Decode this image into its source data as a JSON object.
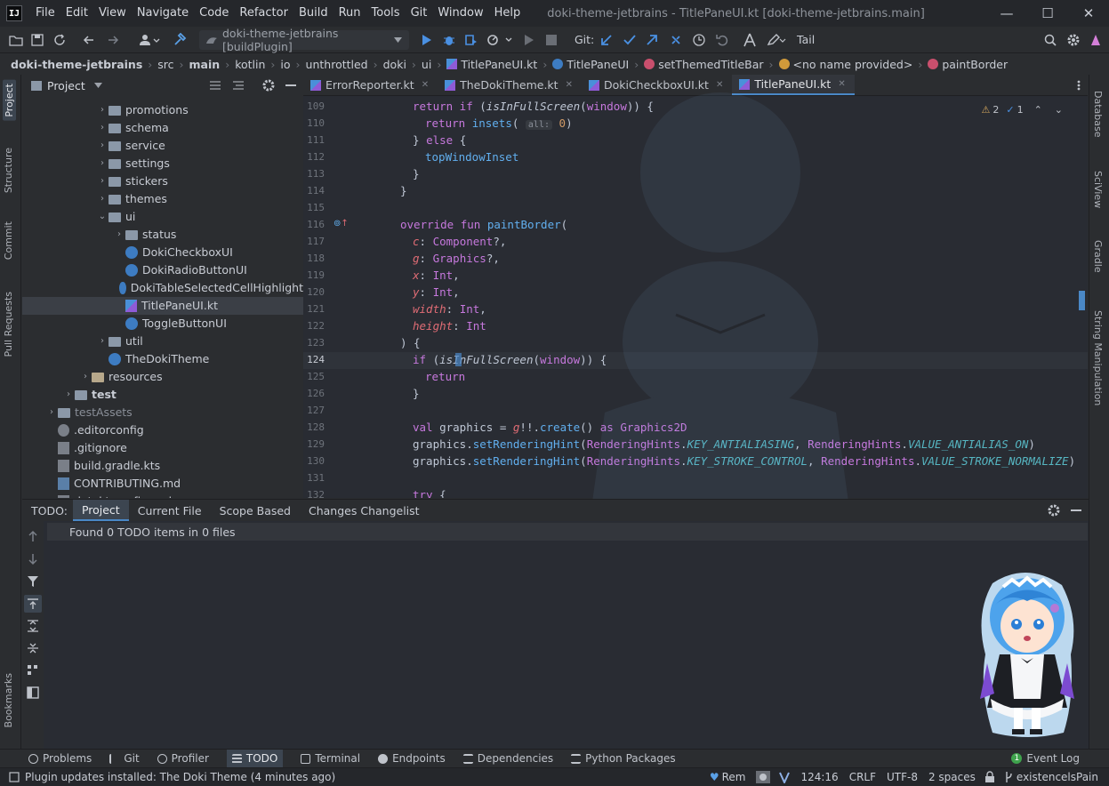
{
  "titlebar": {
    "logo": "IJ",
    "menu": [
      "File",
      "Edit",
      "View",
      "Navigate",
      "Code",
      "Refactor",
      "Build",
      "Run",
      "Tools",
      "Git",
      "Window",
      "Help"
    ],
    "window_title": "doki-theme-jetbrains - TitlePaneUI.kt [doki-theme-jetbrains.main]",
    "minimize": "—",
    "maximize": "☐",
    "close": "✕"
  },
  "toolbar": {
    "run_config": "doki-theme-jetbrains [buildPlugin]",
    "git_label": "Git:",
    "tail_label": "Tail"
  },
  "breadcrumb": [
    "doki-theme-jetbrains",
    "src",
    "main",
    "kotlin",
    "io",
    "unthrottled",
    "doki",
    "ui",
    "TitlePaneUI.kt",
    "TitlePaneUI",
    "setThemedTitleBar",
    "<no name provided>",
    "paintBorder"
  ],
  "left_strip": [
    "Project",
    "Structure",
    "Commit",
    "Pull Requests",
    "Bookmarks"
  ],
  "project_panel": {
    "title": "Project",
    "items": [
      {
        "label": "promotions",
        "depth": 3,
        "type": "folder",
        "arrow": "›"
      },
      {
        "label": "schema",
        "depth": 3,
        "type": "folder",
        "arrow": "›"
      },
      {
        "label": "service",
        "depth": 3,
        "type": "folder",
        "arrow": "›"
      },
      {
        "label": "settings",
        "depth": 3,
        "type": "folder",
        "arrow": "›"
      },
      {
        "label": "stickers",
        "depth": 3,
        "type": "folder",
        "arrow": "›"
      },
      {
        "label": "themes",
        "depth": 3,
        "type": "folder",
        "arrow": "›"
      },
      {
        "label": "ui",
        "depth": 3,
        "type": "folder",
        "arrow": "⌄"
      },
      {
        "label": "status",
        "depth": 4,
        "type": "folder",
        "arrow": "›"
      },
      {
        "label": "DokiCheckboxUI",
        "depth": 4,
        "type": "kt",
        "arrow": ""
      },
      {
        "label": "DokiRadioButtonUI",
        "depth": 4,
        "type": "kt",
        "arrow": ""
      },
      {
        "label": "DokiTableSelectedCellHighlight",
        "depth": 4,
        "type": "kt",
        "arrow": ""
      },
      {
        "label": "TitlePaneUI.kt",
        "depth": 4,
        "type": "ktfile",
        "arrow": ""
      },
      {
        "label": "ToggleButtonUI",
        "depth": 4,
        "type": "kt",
        "arrow": ""
      },
      {
        "label": "util",
        "depth": 3,
        "type": "folder",
        "arrow": "›"
      },
      {
        "label": "TheDokiTheme",
        "depth": 3,
        "type": "kt",
        "arrow": ""
      },
      {
        "label": "resources",
        "depth": 2,
        "type": "folder-brown",
        "arrow": "›"
      },
      {
        "label": "test",
        "depth": 1,
        "type": "folder",
        "arrow": "›"
      },
      {
        "label": "testAssets",
        "depth": 0,
        "type": "folder",
        "arrow": "›"
      },
      {
        "label": ".editorconfig",
        "depth": 0,
        "type": "gear",
        "arrow": ""
      },
      {
        "label": ".gitignore",
        "depth": 0,
        "type": "file",
        "arrow": ""
      },
      {
        "label": "build.gradle.kts",
        "depth": 0,
        "type": "file",
        "arrow": ""
      },
      {
        "label": "CONTRIBUTING.md",
        "depth": 0,
        "type": "md",
        "arrow": ""
      },
      {
        "label": "detekt-config.yml",
        "depth": 0,
        "type": "file",
        "arrow": ""
      }
    ]
  },
  "editor": {
    "tabs": [
      "ErrorReporter.kt",
      "TheDokiTheme.kt",
      "DokiCheckboxUI.kt",
      "TitlePaneUI.kt"
    ],
    "active_tab": 3,
    "inspection": {
      "warnings": "2",
      "typos": "1"
    },
    "line_numbers": [
      "109",
      "110",
      "111",
      "112",
      "113",
      "114",
      "115",
      "116",
      "117",
      "118",
      "119",
      "120",
      "121",
      "122",
      "123",
      "124",
      "125",
      "126",
      "127",
      "128",
      "129",
      "130",
      "131",
      "132"
    ],
    "current_line": "124"
  },
  "right_strip": [
    "Database",
    "SciView",
    "Gradle",
    "String Manipulation"
  ],
  "todo": {
    "label": "TODO:",
    "tabs": [
      "Project",
      "Current File",
      "Scope Based",
      "Changes Changelist"
    ],
    "result": "Found 0 TODO items in 0 files"
  },
  "bottom_tabs": [
    "Problems",
    "Git",
    "Profiler",
    "TODO",
    "Terminal",
    "Endpoints",
    "Dependencies",
    "Python Packages"
  ],
  "event_log": {
    "count": "1",
    "label": "Event Log"
  },
  "status": {
    "message": "Plugin updates installed: The Doki Theme (4 minutes ago)",
    "rem": "Rem",
    "position": "124:16",
    "line_sep": "CRLF",
    "encoding": "UTF-8",
    "indent": "2 spaces",
    "branch": "existencelsPain"
  },
  "colors": {
    "accent": "#4a88c7",
    "background": "#292c33",
    "keyword": "#c678dd",
    "function": "#61afef"
  }
}
